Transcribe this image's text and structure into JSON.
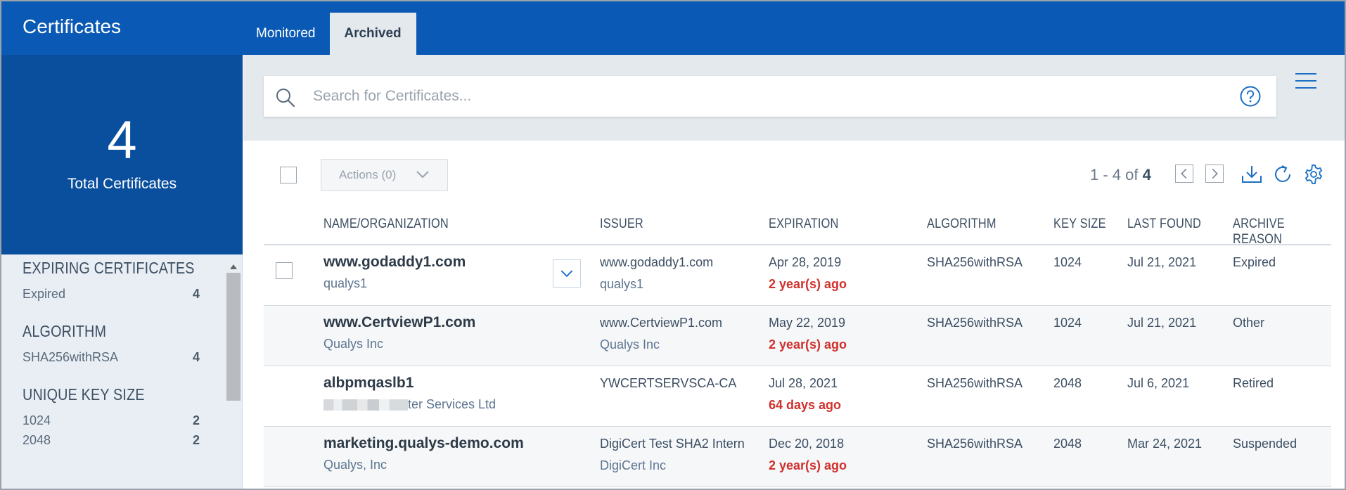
{
  "app": {
    "title": "Certificates"
  },
  "tabs": [
    {
      "label": "Monitored",
      "active": false
    },
    {
      "label": "Archived",
      "active": true
    }
  ],
  "summary": {
    "total": "4",
    "total_label": "Total Certificates"
  },
  "facets": [
    {
      "title": "EXPIRING CERTIFICATES",
      "items": [
        {
          "label": "Expired",
          "count": "4"
        }
      ]
    },
    {
      "title": "ALGORITHM",
      "items": [
        {
          "label": "SHA256withRSA",
          "count": "4"
        }
      ]
    },
    {
      "title": "UNIQUE KEY SIZE",
      "items": [
        {
          "label": "1024",
          "count": "2"
        },
        {
          "label": "2048",
          "count": "2"
        }
      ]
    }
  ],
  "search": {
    "placeholder": "Search for Certificates...",
    "value": ""
  },
  "toolbar": {
    "actions_label": "Actions (0)",
    "pager_range": "1 - 4 of",
    "pager_total": "4"
  },
  "table": {
    "columns": [
      "NAME/ORGANIZATION",
      "ISSUER",
      "EXPIRATION",
      "ALGORITHM",
      "KEY SIZE",
      "LAST FOUND",
      "ARCHIVE REASON"
    ],
    "rows": [
      {
        "name": "www.godaddy1.com",
        "org": "qualys1",
        "issuer": "www.godaddy1.com",
        "issuer_org": "qualys1",
        "expiration": "Apr 28, 2019",
        "expiration_rel": "2 year(s) ago",
        "algorithm": "SHA256withRSA",
        "key_size": "1024",
        "last_found": "Jul 21, 2021",
        "archive_reason": "Expired"
      },
      {
        "name": "www.CertviewP1.com",
        "org": "Qualys Inc",
        "issuer": "www.CertviewP1.com",
        "issuer_org": "Qualys Inc",
        "expiration": "May 22, 2019",
        "expiration_rel": "2 year(s) ago",
        "algorithm": "SHA256withRSA",
        "key_size": "1024",
        "last_found": "Jul 21, 2021",
        "archive_reason": "Other"
      },
      {
        "name": "albpmqaslb1",
        "org": "ter Services Ltd",
        "issuer": "YWCERTSERVSCA-CA",
        "issuer_org": "",
        "expiration": "Jul 28, 2021",
        "expiration_rel": "64 days ago",
        "algorithm": "SHA256withRSA",
        "key_size": "2048",
        "last_found": "Jul 6, 2021",
        "archive_reason": "Retired"
      },
      {
        "name": "marketing.qualys-demo.com",
        "org": "Qualys, Inc",
        "issuer": "DigiCert Test SHA2 Intern",
        "issuer_org": "DigiCert Inc",
        "expiration": "Dec 20, 2018",
        "expiration_rel": "2 year(s) ago",
        "algorithm": "SHA256withRSA",
        "key_size": "2048",
        "last_found": "Mar 24, 2021",
        "archive_reason": "Suspended"
      }
    ]
  },
  "colors": {
    "header_bg": "#0a5ab5",
    "total_bg": "#0a4f9e",
    "accent": "#1a6fc4",
    "danger": "#d0312d"
  },
  "icons": [
    "search-icon",
    "help-icon",
    "menu-icon",
    "chevron-down-icon",
    "chevron-left-icon",
    "chevron-right-icon",
    "download-icon",
    "refresh-icon",
    "gear-icon"
  ]
}
